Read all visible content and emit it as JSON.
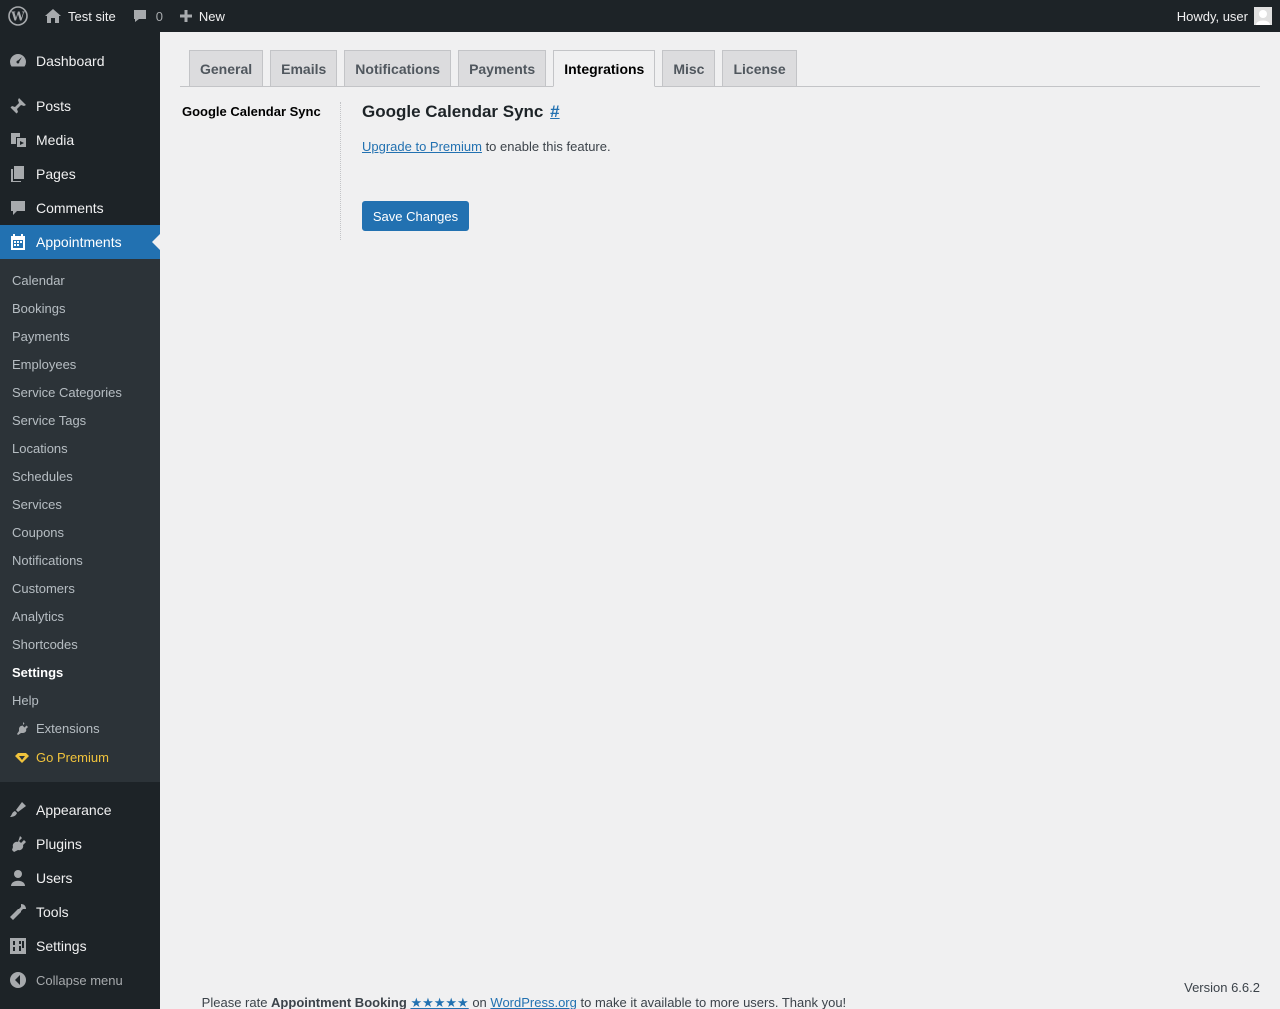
{
  "adminbar": {
    "site_name": "Test site",
    "comments_count": "0",
    "new_label": "New",
    "greeting": "Howdy, user"
  },
  "sidebar": {
    "top_before": [
      {
        "label": "Dashboard",
        "icon": "dashboard-icon"
      },
      {
        "label": "Posts",
        "icon": "pin-icon"
      },
      {
        "label": "Media",
        "icon": "media-icon"
      },
      {
        "label": "Pages",
        "icon": "pages-icon"
      },
      {
        "label": "Comments",
        "icon": "comment-icon"
      }
    ],
    "current": {
      "label": "Appointments",
      "icon": "calendar-icon"
    },
    "submenu": [
      "Calendar",
      "Bookings",
      "Payments",
      "Employees",
      "Service Categories",
      "Service Tags",
      "Locations",
      "Schedules",
      "Services",
      "Coupons",
      "Notifications",
      "Customers",
      "Analytics",
      "Shortcodes",
      "Settings",
      "Help"
    ],
    "extensions": "Extensions",
    "go_premium": "Go Premium",
    "top_after": [
      {
        "label": "Appearance",
        "icon": "brush-icon"
      },
      {
        "label": "Plugins",
        "icon": "plugin-icon"
      },
      {
        "label": "Users",
        "icon": "user-icon"
      },
      {
        "label": "Tools",
        "icon": "wrench-icon"
      },
      {
        "label": "Settings",
        "icon": "settings-icon"
      }
    ],
    "collapse": "Collapse menu"
  },
  "tabs": [
    "General",
    "Emails",
    "Notifications",
    "Payments",
    "Integrations",
    "Misc",
    "License"
  ],
  "active_tab": "Integrations",
  "subnav": "Google Calendar Sync",
  "section": {
    "title": "Google Calendar Sync",
    "anchor": "#",
    "upgrade_link": "Upgrade to Premium",
    "message_rest": " to enable this feature.",
    "save_button": "Save Changes"
  },
  "footer": {
    "prefix": "Please rate ",
    "plugin_name": "Appointment Booking",
    "stars": "★★★★★",
    "on": " on ",
    "wporg": "WordPress.org",
    "suffix": " to make it available to more users. Thank you!",
    "version": "Version 6.6.2"
  },
  "colors": {
    "accent": "#2271b1",
    "sidebar": "#1d2327",
    "submenu": "#2c3338",
    "premium": "#f0c33c"
  }
}
